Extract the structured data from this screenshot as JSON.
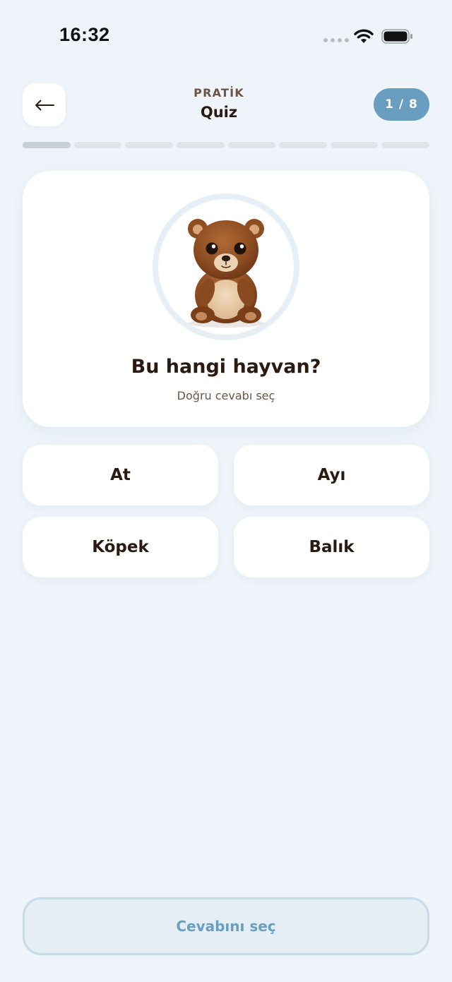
{
  "status_bar": {
    "time": "16:32",
    "icons": [
      "signal-dots-icon",
      "wifi-icon",
      "battery-icon"
    ]
  },
  "header": {
    "back_icon": "arrow-left-icon",
    "eyebrow": "PRATİK",
    "title": "Quiz",
    "progress_label": "1 / 8"
  },
  "progress": {
    "current": 1,
    "total": 8
  },
  "question": {
    "image": "bear-illustration",
    "title": "Bu hangi hayvan?",
    "hint": "Doğru cevabı seç"
  },
  "options": [
    {
      "label": "At"
    },
    {
      "label": "Ayı"
    },
    {
      "label": "Köpek"
    },
    {
      "label": "Balık"
    }
  ],
  "submit": {
    "label": "Cevabını seç"
  },
  "colors": {
    "background": "#eef4f9",
    "accent": "#6a9ec1",
    "text_primary": "#2a1a10",
    "text_secondary": "#6b5547",
    "card": "#ffffff"
  }
}
